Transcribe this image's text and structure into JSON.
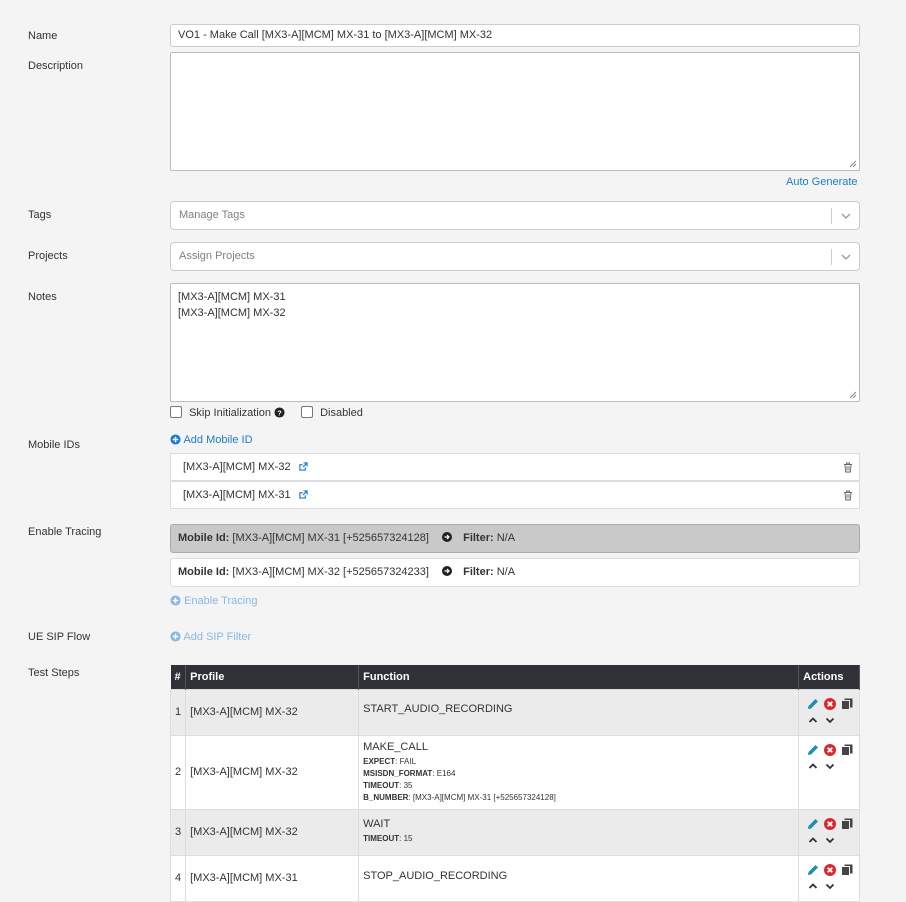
{
  "form": {
    "name_label": "Name",
    "name_value": "VO1 - Make Call [MX3-A][MCM] MX-31 to [MX3-A][MCM] MX-32",
    "description_label": "Description",
    "description_value": "",
    "auto_generate": "Auto Generate",
    "tags_label": "Tags",
    "tags_placeholder": "Manage Tags",
    "projects_label": "Projects",
    "projects_placeholder": "Assign Projects",
    "notes_label": "Notes",
    "notes_lines": [
      "[MX3-A][MCM] MX-31",
      "[MX3-A][MCM] MX-32"
    ],
    "skip_init_label": "Skip Initialization",
    "disabled_label": "Disabled"
  },
  "mobile_ids": {
    "label": "Mobile IDs",
    "add_label": "Add Mobile ID",
    "items": [
      {
        "name": "[MX3-A][MCM] MX-32"
      },
      {
        "name": "[MX3-A][MCM] MX-31"
      }
    ]
  },
  "tracing": {
    "label": "Enable Tracing",
    "mobile_id_key": "Mobile Id:",
    "filter_key": "Filter:",
    "items": [
      {
        "mobile": "[MX3-A][MCM] MX-31 [+525657324128]",
        "filter": "N/A",
        "highlighted": true
      },
      {
        "mobile": "[MX3-A][MCM] MX-32 [+525657324233]",
        "filter": "N/A",
        "highlighted": false
      }
    ],
    "enable_link": "Enable Tracing"
  },
  "sip_flow": {
    "label": "UE SIP Flow",
    "add_link": "Add SIP Filter"
  },
  "test_steps": {
    "label": "Test Steps",
    "columns": [
      "#",
      "Profile",
      "Function",
      "Actions"
    ],
    "rows": [
      {
        "num": "1",
        "profile": "[MX3-A][MCM] MX-32",
        "function": "START_AUDIO_RECORDING",
        "params": []
      },
      {
        "num": "2",
        "profile": "[MX3-A][MCM] MX-32",
        "function": "MAKE_CALL",
        "params": [
          {
            "key": "EXPECT",
            "value": ": FAIL"
          },
          {
            "key": "MSISDN_FORMAT",
            "value": ": E164"
          },
          {
            "key": "TIMEOUT",
            "value": ": 35"
          },
          {
            "key": "B_NUMBER",
            "value": ": [MX3-A][MCM] MX-31 [+525657324128]"
          }
        ]
      },
      {
        "num": "3",
        "profile": "[MX3-A][MCM] MX-32",
        "function": "WAIT",
        "params": [
          {
            "key": "TIMEOUT",
            "value": ": 15"
          }
        ]
      },
      {
        "num": "4",
        "profile": "[MX3-A][MCM] MX-31",
        "function": "STOP_AUDIO_RECORDING",
        "params": []
      }
    ]
  },
  "colors": {
    "accent": "#1a7ec9",
    "header_bg": "#2f3136",
    "edit_icon": "#1f8fb0",
    "delete_icon": "#d9292f"
  }
}
